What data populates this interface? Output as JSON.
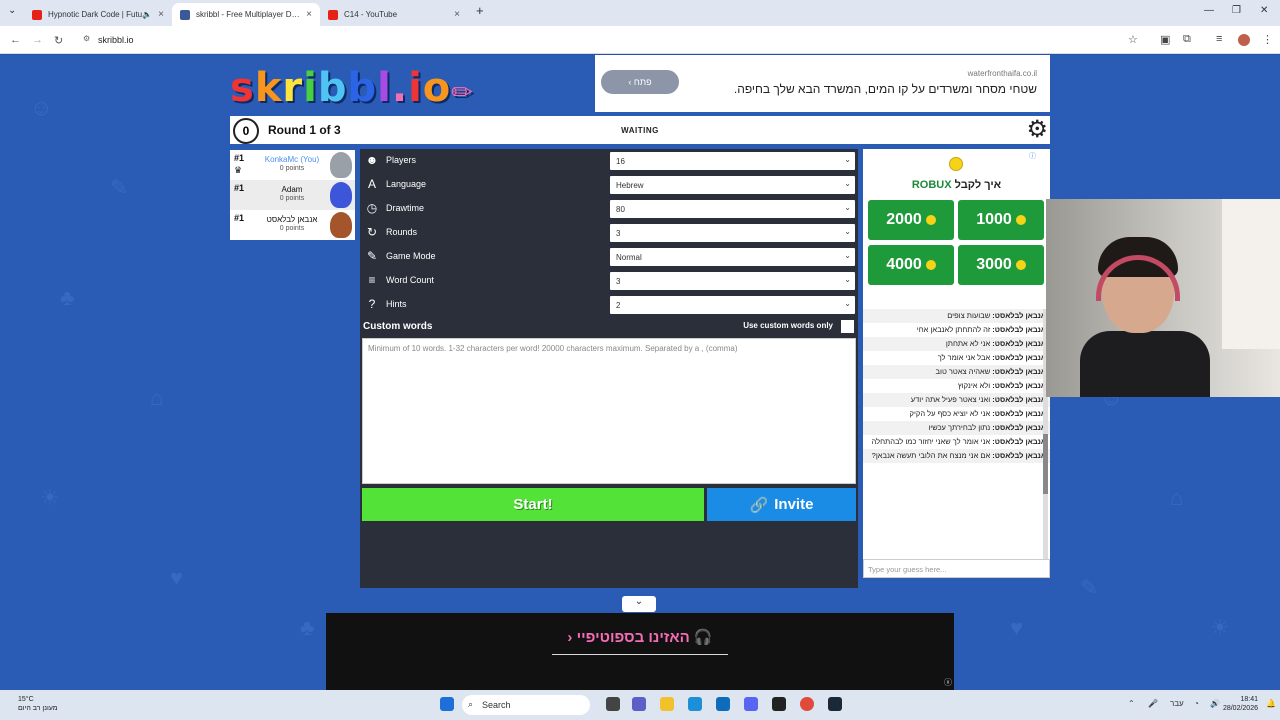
{
  "browser": {
    "tabs": [
      {
        "title": "Hypnotic Dark Code | Futu",
        "icon": "youtube-icon",
        "color": "#e62117",
        "active": false
      },
      {
        "title": "skribbl - Free Multiplayer Draw",
        "icon": "skribbl-icon",
        "color": "#3b5998",
        "active": true
      },
      {
        "title": "C14 - YouTube",
        "icon": "youtube-icon",
        "color": "#e62117",
        "active": false
      }
    ],
    "url": "skribbl.io"
  },
  "ad_top": {
    "button": "פתח",
    "source": "waterfronthaifa.co.il",
    "text": "שטחי מסחר ומשרדים על קו המים, המשרד הבא שלך בחיפה."
  },
  "game": {
    "logo": "skribbl.io",
    "logo_colors": [
      "#ee3434",
      "#f7951d",
      "#fde33c",
      "#47d13f",
      "#4fc4f4",
      "#2c64e6",
      "#a84ae4",
      "#f36db4",
      "#ee3434",
      "#f7951d"
    ],
    "clock": "0",
    "round": "Round 1 of 3",
    "status": "WAITING"
  },
  "players": [
    {
      "rank": "#1",
      "name": "KonkaMc (You)",
      "points": "0 points",
      "me": true,
      "avatar_color": "#9aa0a8"
    },
    {
      "rank": "#1",
      "name": "Adam",
      "points": "0 points",
      "me": false,
      "avatar_color": "#3d55d8"
    },
    {
      "rank": "#1",
      "name": "אנבאן לבלאסט",
      "points": "0 points",
      "me": false,
      "avatar_color": "#a4552b"
    }
  ],
  "settings": [
    {
      "icon": "players-icon",
      "label": "Players",
      "value": "16"
    },
    {
      "icon": "language-icon",
      "label": "Language",
      "value": "Hebrew"
    },
    {
      "icon": "drawtime-icon",
      "label": "Drawtime",
      "value": "80"
    },
    {
      "icon": "rounds-icon",
      "label": "Rounds",
      "value": "3"
    },
    {
      "icon": "game-mode-icon",
      "label": "Game Mode",
      "value": "Normal"
    },
    {
      "icon": "word-count-icon",
      "label": "Word Count",
      "value": "3"
    },
    {
      "icon": "hints-icon",
      "label": "Hints",
      "value": "2"
    }
  ],
  "custom_words": {
    "title": "Custom words",
    "only_label": "Use custom words only",
    "placeholder": "Minimum of 10 words. 1-32 characters per word! 20000 characters maximum. Separated by a , (comma)"
  },
  "buttons": {
    "start": "Start!",
    "invite": "Invite"
  },
  "robux_ad": {
    "heading_robux": "ROBUX",
    "heading_text": "איך לקבל",
    "amounts": [
      "2000",
      "1000",
      "4000",
      "3000"
    ]
  },
  "chat": [
    {
      "name": "אנבאן לבלאסט:",
      "text": "שבועות צופים"
    },
    {
      "name": "אנבאן לבלאסט:",
      "text": "זה להתחתן לאנבאן אחי"
    },
    {
      "name": "אנבאן לבלאסט:",
      "text": "אני לא אתחתן"
    },
    {
      "name": "אנבאן לבלאסט:",
      "text": "אבל אני אומר לך"
    },
    {
      "name": "אנבאן לבלאסט:",
      "text": "שאהיה צאטר טוב"
    },
    {
      "name": "אנבאן לבלאסט:",
      "text": "ולא אינקוץ"
    },
    {
      "name": "אנבאן לבלאסט:",
      "text": "ואני צאטר פעיל אתה יודע"
    },
    {
      "name": "אנבאן לבלאסט:",
      "text": "אני לא יוציא כסף על הקיק"
    },
    {
      "name": "אנבאן לבלאסט:",
      "text": "נתון לבחירתך עכשיו"
    },
    {
      "name": "אנבאן לבלאסט:",
      "text": "אני אומר לך שאני יחזור כמו לבהתחלה"
    },
    {
      "name": "אנבאן לבלאסט:",
      "text": "אם אני מנצח את הלובי תעשה אנבאן?"
    }
  ],
  "guess_placeholder": "Type your guess here...",
  "banner": {
    "text": "האזינו בספוטיפיי"
  },
  "taskbar": {
    "weather_temp": "15°C",
    "weather_desc": "מעונן רב היום",
    "search": "Search",
    "lang": "עבר",
    "time": "18:41",
    "date": "28/02/2026"
  }
}
